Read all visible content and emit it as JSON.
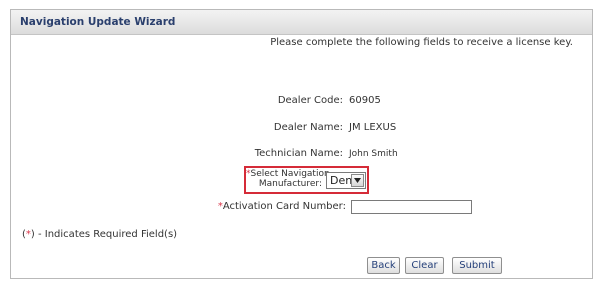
{
  "wizard": {
    "title": "Navigation Update Wizard",
    "instruction": "Please complete the following fields to receive a license key."
  },
  "fields": {
    "dealer_code": {
      "label": "Dealer Code:",
      "value": "60905"
    },
    "dealer_name": {
      "label": "Dealer Name:",
      "value": "JM LEXUS"
    },
    "technician_name": {
      "label": "Technician Name:",
      "value": "John Smith"
    },
    "navigation_manufacturer": {
      "required_marker": "*",
      "label_line1": "Select Navigation",
      "label_line2": "Manufacturer:",
      "selected": "Denso"
    },
    "activation_card_number": {
      "required_marker": "*",
      "label": "Activation Card Number:",
      "value": ""
    }
  },
  "required_note": {
    "open_paren": "(",
    "marker": "*",
    "rest": ") - Indicates Required Field(s)"
  },
  "buttons": {
    "back": "Back",
    "clear": "Clear",
    "submit": "Submit"
  },
  "colors": {
    "required": "#d9364a",
    "highlight_border": "#d52b38",
    "title_text": "#2a3f6d",
    "button_text": "#243f79"
  }
}
